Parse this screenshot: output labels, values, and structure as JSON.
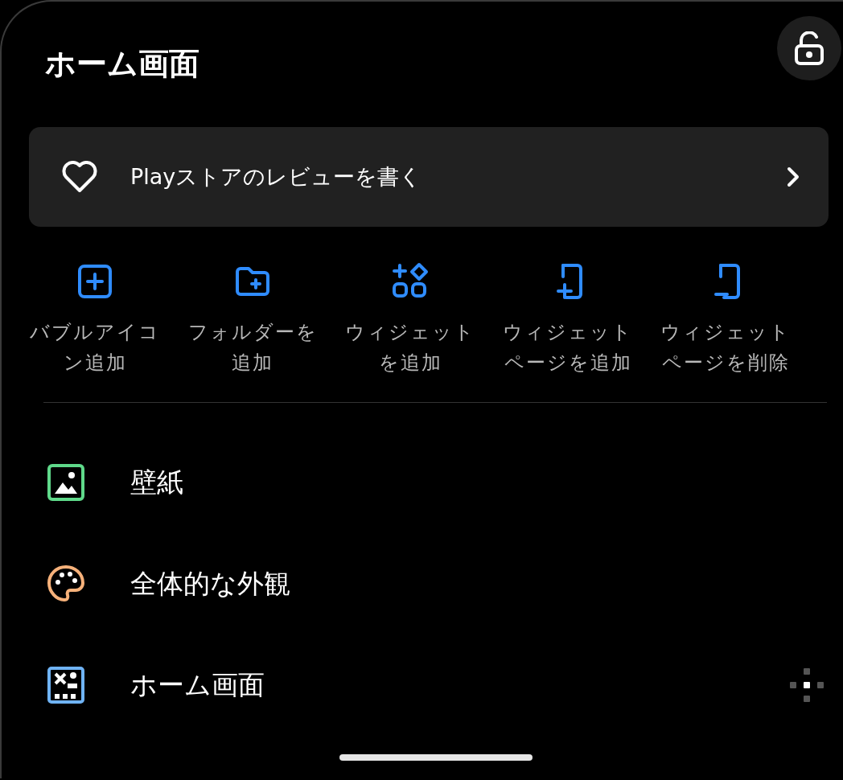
{
  "title": "ホーム画面",
  "review_card": {
    "label": "Playストアのレビューを書く"
  },
  "quick_actions": [
    {
      "label": "バブルアイコン追加"
    },
    {
      "label": "フォルダーを追加"
    },
    {
      "label": "ウィジェットを追加"
    },
    {
      "label": "ウィジェットページを追加"
    },
    {
      "label": "ウィジェットページを削除"
    }
  ],
  "settings": [
    {
      "label": "壁紙",
      "color": "#5fd98a",
      "handle": false
    },
    {
      "label": "全体的な外観",
      "color": "#f6b17a",
      "handle": false
    },
    {
      "label": "ホーム画面",
      "color": "#6fb3f5",
      "handle": true
    }
  ]
}
